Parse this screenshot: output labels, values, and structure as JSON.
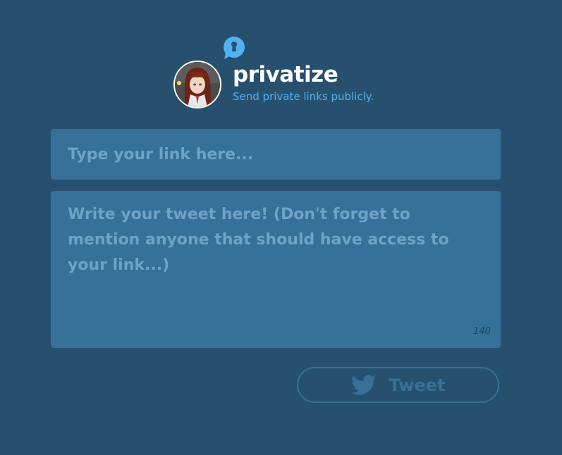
{
  "app": {
    "name": "privatize",
    "tagline": "Send private links publicly."
  },
  "icons": {
    "lock": "keyhole-lock-icon",
    "avatar": "user-avatar",
    "tweet": "twitter-bird-icon"
  },
  "form": {
    "link_placeholder": "Type your link here...",
    "link_value": "",
    "tweet_placeholder": "Write your tweet here! (Don't forget to mention anyone that should have access to your link...)",
    "tweet_value": "",
    "char_count": "140"
  },
  "button": {
    "tweet_label": "Tweet"
  },
  "colors": {
    "background": "#27506f",
    "field": "#357198",
    "placeholder": "#6ea3c6",
    "accent": "#4fb3f2",
    "title": "#ffffff"
  }
}
